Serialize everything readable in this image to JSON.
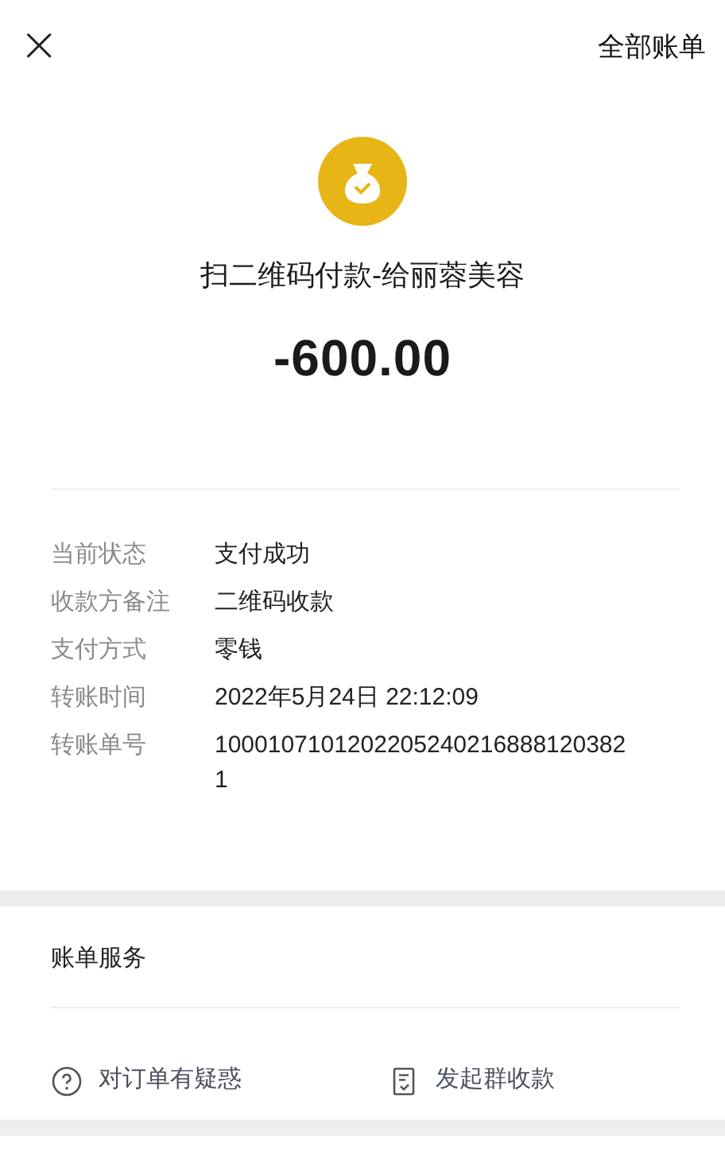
{
  "header": {
    "close": "×",
    "right_link": "全部账单"
  },
  "summary": {
    "title": "扫二维码付款-给丽蓉美容",
    "amount": "-600.00"
  },
  "details": [
    {
      "label": "当前状态",
      "value": "支付成功"
    },
    {
      "label": "收款方备注",
      "value": "二维码收款"
    },
    {
      "label": "支付方式",
      "value": "零钱"
    },
    {
      "label": "转账时间",
      "value": "2022年5月24日 22:12:09"
    },
    {
      "label": "转账单号",
      "value": "10001071012022052402168881203821"
    }
  ],
  "services": {
    "title": "账单服务",
    "actions": [
      {
        "kind": "question",
        "label": "对订单有疑惑"
      },
      {
        "kind": "group",
        "label": "发起群收款"
      }
    ]
  }
}
